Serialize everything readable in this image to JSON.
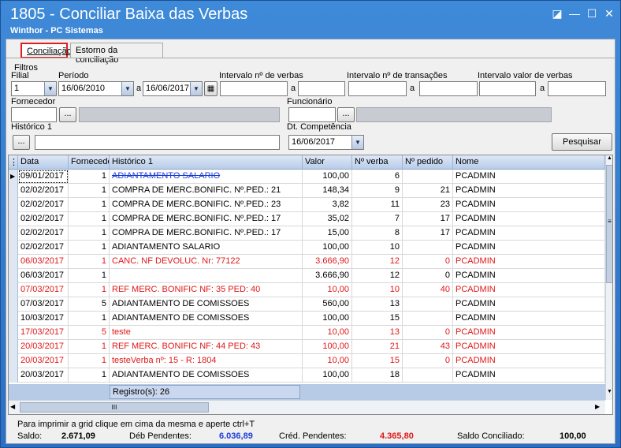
{
  "window": {
    "title": "1805 - Conciliar Baixa das Verbas",
    "subtitle": "Winthor - PC Sistemas",
    "restore_glyph": "◪",
    "minimize_glyph": "—",
    "maximize_glyph": "☐",
    "close_glyph": "✕"
  },
  "tabs": [
    {
      "label": "Conciliação"
    },
    {
      "label": "Estorno da conciliação"
    }
  ],
  "filters": {
    "group_label": "Filtros",
    "filial_label": "Filial",
    "filial_value": "1",
    "periodo_label": "Período",
    "periodo_from": "16/06/2010",
    "a_label": "a",
    "periodo_to": "16/06/2017",
    "intervalo_verbas_label": "Intervalo nº de verbas",
    "intervalo_transacoes_label": "Intervalo nº de transações",
    "intervalo_valor_label": "Intervalo valor de verbas",
    "fornecedor_label": "Fornecedor",
    "funcionario_label": "Funcionário",
    "historico_label": "Histórico 1",
    "dt_competencia_label": "Dt. Competência",
    "dt_competencia_value": "16/06/2017",
    "ellipsis": "...",
    "pesquisar_label": "Pesquisar"
  },
  "grid": {
    "columns": [
      "Data",
      "Fornecedor",
      "Histórico 1",
      "Valor",
      "Nº verba",
      "Nº pedido",
      "Nome"
    ],
    "rows": [
      {
        "data": "09/01/2017",
        "forn": "1",
        "hist": "ADIANTAMENTO SALARIO",
        "valor": "100,00",
        "verba": "6",
        "pedido": "",
        "nome": "PCADMIN",
        "red": false,
        "strike": true
      },
      {
        "data": "02/02/2017",
        "forn": "1",
        "hist": "COMPRA DE MERC.BONIFIC. Nº.PED.: 21",
        "valor": "148,34",
        "verba": "9",
        "pedido": "21",
        "nome": "PCADMIN",
        "red": false
      },
      {
        "data": "02/02/2017",
        "forn": "1",
        "hist": "COMPRA DE MERC.BONIFIC. Nº.PED.: 23",
        "valor": "3,82",
        "verba": "11",
        "pedido": "23",
        "nome": "PCADMIN",
        "red": false
      },
      {
        "data": "02/02/2017",
        "forn": "1",
        "hist": "COMPRA DE MERC.BONIFIC. Nº.PED.: 17",
        "valor": "35,02",
        "verba": "7",
        "pedido": "17",
        "nome": "PCADMIN",
        "red": false
      },
      {
        "data": "02/02/2017",
        "forn": "1",
        "hist": "COMPRA DE MERC.BONIFIC. Nº.PED.: 17",
        "valor": "15,00",
        "verba": "8",
        "pedido": "17",
        "nome": "PCADMIN",
        "red": false
      },
      {
        "data": "02/02/2017",
        "forn": "1",
        "hist": "ADIANTAMENTO SALARIO",
        "valor": "100,00",
        "verba": "10",
        "pedido": "",
        "nome": "PCADMIN",
        "red": false
      },
      {
        "data": "06/03/2017",
        "forn": "1",
        "hist": "CANC. NF DEVOLUC. Nr: 77122",
        "valor": "3.666,90",
        "verba": "12",
        "pedido": "0",
        "nome": "PCADMIN",
        "red": true
      },
      {
        "data": "06/03/2017",
        "forn": "1",
        "hist": "",
        "valor": "3.666,90",
        "verba": "12",
        "pedido": "0",
        "nome": "PCADMIN",
        "red": false
      },
      {
        "data": "07/03/2017",
        "forn": "1",
        "hist": "REF MERC. BONIFIC NF: 35 PED: 40",
        "valor": "10,00",
        "verba": "10",
        "pedido": "40",
        "nome": "PCADMIN",
        "red": true
      },
      {
        "data": "07/03/2017",
        "forn": "5",
        "hist": "ADIANTAMENTO DE COMISSOES",
        "valor": "560,00",
        "verba": "13",
        "pedido": "",
        "nome": "PCADMIN",
        "red": false
      },
      {
        "data": "10/03/2017",
        "forn": "1",
        "hist": "ADIANTAMENTO DE COMISSOES",
        "valor": "100,00",
        "verba": "15",
        "pedido": "",
        "nome": "PCADMIN",
        "red": false
      },
      {
        "data": "17/03/2017",
        "forn": "5",
        "hist": "teste",
        "valor": "10,00",
        "verba": "13",
        "pedido": "0",
        "nome": "PCADMIN",
        "red": true
      },
      {
        "data": "20/03/2017",
        "forn": "1",
        "hist": "REF MERC. BONIFIC NF: 44 PED: 43",
        "valor": "100,00",
        "verba": "21",
        "pedido": "43",
        "nome": "PCADMIN",
        "red": true
      },
      {
        "data": "20/03/2017",
        "forn": "1",
        "hist": "testeVerba nº: 15 - R: 1804",
        "valor": "10,00",
        "verba": "15",
        "pedido": "0",
        "nome": "PCADMIN",
        "red": true
      },
      {
        "data": "20/03/2017",
        "forn": "1",
        "hist": "ADIANTAMENTO DE COMISSOES",
        "valor": "100,00",
        "verba": "18",
        "pedido": "",
        "nome": "PCADMIN",
        "red": false
      }
    ],
    "footer_registros": "Registro(s): 26",
    "hscroll_grip": "III",
    "vscroll_grip": "≡"
  },
  "status": {
    "hint": "Para imprimir a grid  clique em cima da mesma e aperte ctrl+T",
    "saldo_label": "Saldo:",
    "saldo_value": "2.671,09",
    "deb_label": "Déb Pendentes:",
    "deb_value": "6.036,89",
    "cred_label": "Créd. Pendentes:",
    "cred_value": "4.365,80",
    "conc_label": "Saldo Conciliado:",
    "conc_value": "100,00",
    "deb_color": "#1a3ad8",
    "cred_color": "#e01818"
  }
}
